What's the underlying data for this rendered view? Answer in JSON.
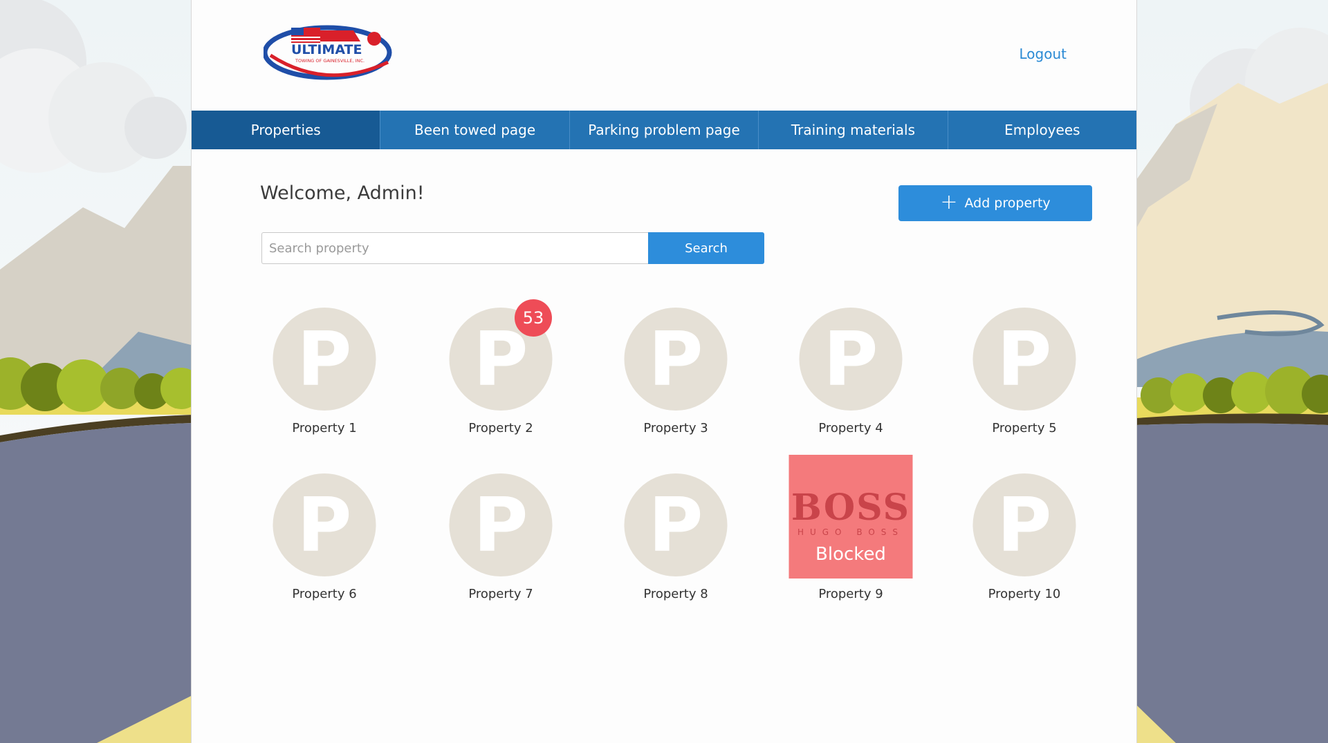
{
  "header": {
    "logo_text": "ULTIMATE",
    "logo_subtext": "TOWING OF GAINESVILLE, INC.",
    "logout_label": "Logout"
  },
  "nav": {
    "items": [
      {
        "label": "Properties",
        "active": true
      },
      {
        "label": "Been towed page",
        "active": false
      },
      {
        "label": "Parking problem page",
        "active": false
      },
      {
        "label": "Training materials",
        "active": false
      },
      {
        "label": "Employees",
        "active": false
      }
    ]
  },
  "main": {
    "welcome": "Welcome, Admin!",
    "add_property_label": "Add property",
    "search": {
      "placeholder": "Search property",
      "value": "",
      "button_label": "Search"
    }
  },
  "properties": [
    {
      "name": "Property 1",
      "icon_letter": "P"
    },
    {
      "name": "Property 2",
      "icon_letter": "P",
      "badge": "53"
    },
    {
      "name": "Property 3",
      "icon_letter": "P"
    },
    {
      "name": "Property 4",
      "icon_letter": "P"
    },
    {
      "name": "Property 5",
      "icon_letter": "P"
    },
    {
      "name": "Property 6",
      "icon_letter": "P"
    },
    {
      "name": "Property 7",
      "icon_letter": "P"
    },
    {
      "name": "Property 8",
      "icon_letter": "P"
    },
    {
      "name": "Property 9",
      "logo_text": "BOSS",
      "logo_subtext": "HUGO BOSS",
      "status": "Blocked"
    },
    {
      "name": "Property 10",
      "icon_letter": "P"
    }
  ],
  "colors": {
    "nav_bg": "#2473b3",
    "nav_active": "#175a94",
    "accent": "#2d8ddb",
    "badge": "#ee4c57",
    "blocked_tile": "#f47a7c",
    "placeholder_circle": "#e5e0d6"
  }
}
